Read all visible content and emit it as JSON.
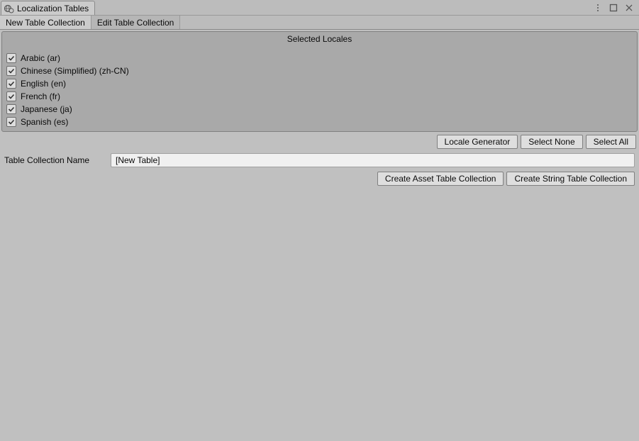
{
  "window": {
    "title": "Localization Tables"
  },
  "tabs": {
    "new_table": "New Table Collection",
    "edit_table": "Edit Table Collection"
  },
  "panel": {
    "header": "Selected Locales"
  },
  "locales": [
    {
      "checked": true,
      "label": "Arabic (ar)"
    },
    {
      "checked": true,
      "label": "Chinese (Simplified) (zh-CN)"
    },
    {
      "checked": true,
      "label": "English (en)"
    },
    {
      "checked": true,
      "label": "French (fr)"
    },
    {
      "checked": true,
      "label": "Japanese (ja)"
    },
    {
      "checked": true,
      "label": "Spanish (es)"
    }
  ],
  "buttons": {
    "locale_generator": "Locale Generator",
    "select_none": "Select None",
    "select_all": "Select All",
    "create_asset": "Create Asset Table Collection",
    "create_string": "Create String Table Collection"
  },
  "name_field": {
    "label": "Table Collection Name",
    "value": "[New Table]"
  }
}
